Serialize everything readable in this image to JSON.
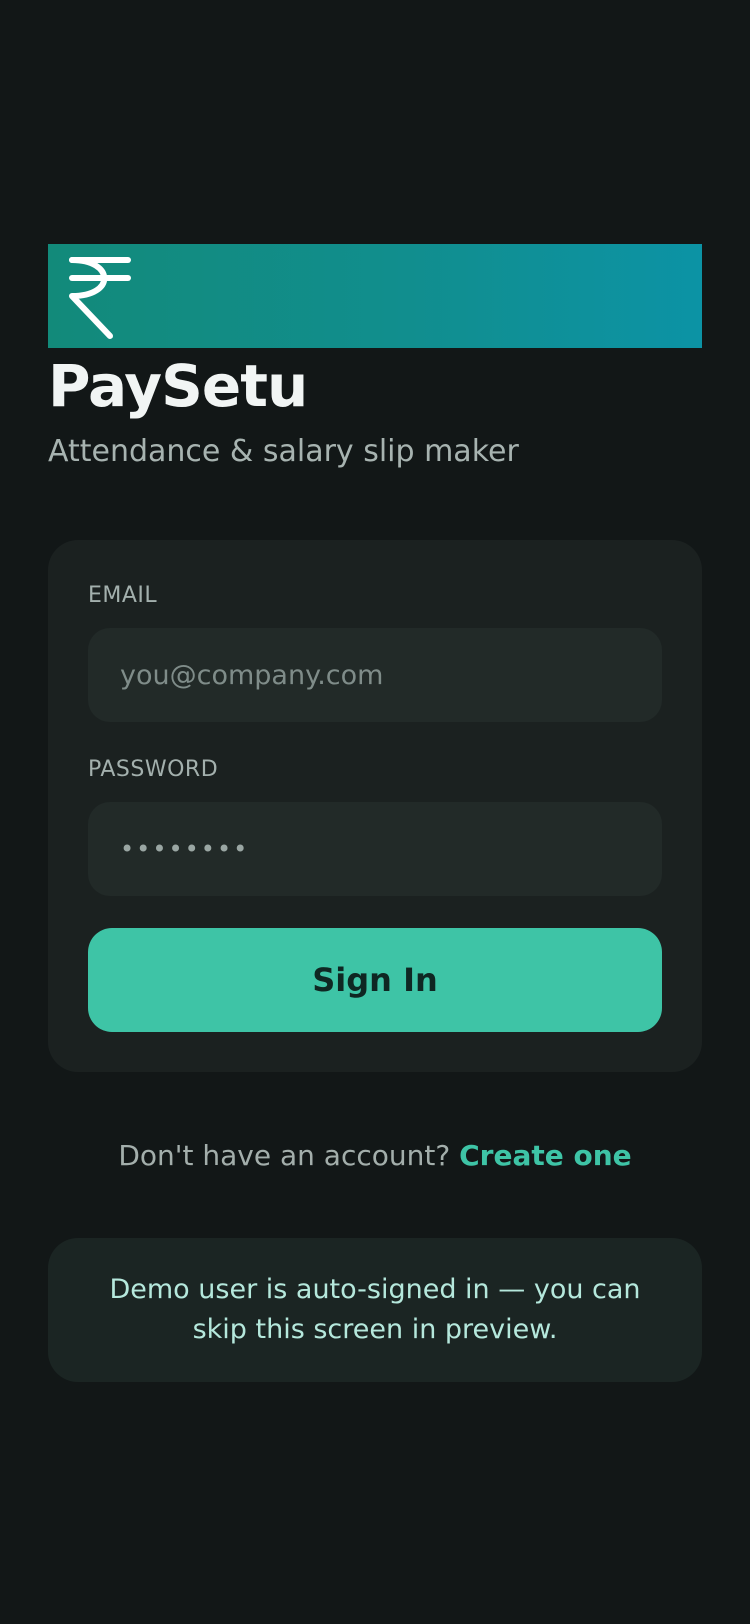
{
  "app": {
    "logo_icon": "rupee-icon",
    "brand_gradient": [
      "#128a7a",
      "#0c93a5"
    ],
    "title": "PaySetu",
    "subtitle": "Attendance & salary slip maker"
  },
  "login_form": {
    "email": {
      "label": "EMAIL",
      "placeholder": "you@company.com",
      "value": ""
    },
    "password": {
      "label": "PASSWORD",
      "value": "••••••••"
    },
    "submit_label": "Sign In",
    "accent_color": "#3ec4a6"
  },
  "signup": {
    "prompt": "Don't have an account? ",
    "link_label": "Create one"
  },
  "demo_note": {
    "text": "Demo user is auto-signed in — you can skip this screen in preview."
  }
}
